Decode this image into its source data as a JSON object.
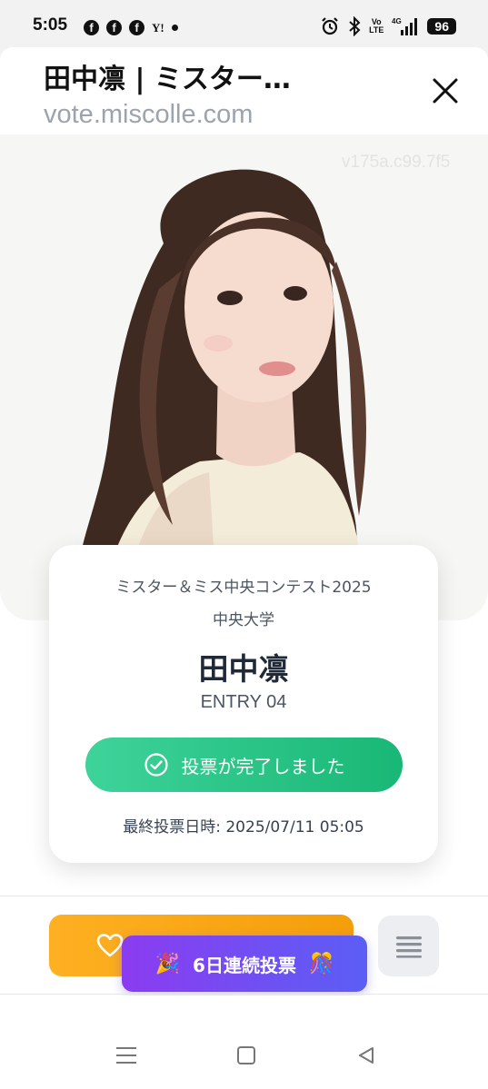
{
  "status_bar": {
    "time": "5:05",
    "notification_icons": [
      "facebook-icon",
      "facebook-icon",
      "facebook-icon",
      "yahoo-icon",
      "dot-icon"
    ],
    "fb_glyph": "f",
    "yahoo_glyph": "Y!",
    "volte_top": "Vo",
    "volte_bottom": "LTE",
    "network": "4G",
    "battery": "96"
  },
  "browser": {
    "title": "田中凛 | ミスター…",
    "url": "vote.miscolle.com"
  },
  "photo": {
    "watermark": "v175a.c99.7f5"
  },
  "card": {
    "contest": "ミスター＆ミス中央コンテスト2025",
    "university": "中央大学",
    "name": "田中凛",
    "entry": "ENTRY 04",
    "vote_status": "投票が完了しました",
    "last_vote": "最終投票日時: 2025/07/11 05:05"
  },
  "streak_badge": {
    "left_emoji": "🎉",
    "label": "6日連続投票",
    "right_emoji": "🎊"
  },
  "colors": {
    "vote_done_green": "#19b776",
    "vote_button_orange": "#f59e0b",
    "streak_purple": "#7c3aed"
  }
}
